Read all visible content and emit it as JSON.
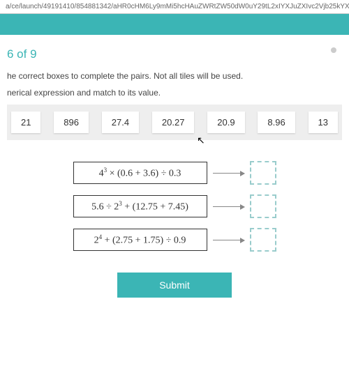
{
  "url": "a/ce/launch/49191410/854881342/aHR0cHM6Ly9mMi5hcHAuZWRtZW50dW0uY29tL2xIYXJuZXIvc2Vjb25kYX",
  "header": {
    "question": "6 of 9"
  },
  "instructions": {
    "line1": "he correct boxes to complete the pairs. Not all tiles will be used.",
    "line2": "nerical expression and match to its value."
  },
  "tiles": [
    "21",
    "896",
    "27.4",
    "20.27",
    "20.9",
    "8.96",
    "13"
  ],
  "expressions": [
    {
      "html": "4<sup>3</sup> × (0.6 + 3.6) ÷ 0.3"
    },
    {
      "html": "5.6 ÷ 2<sup>3</sup> + (12.75 + 7.45)"
    },
    {
      "html": "2<sup>4</sup> + (2.75 + 1.75) ÷ 0.9"
    }
  ],
  "submit": "Submit"
}
